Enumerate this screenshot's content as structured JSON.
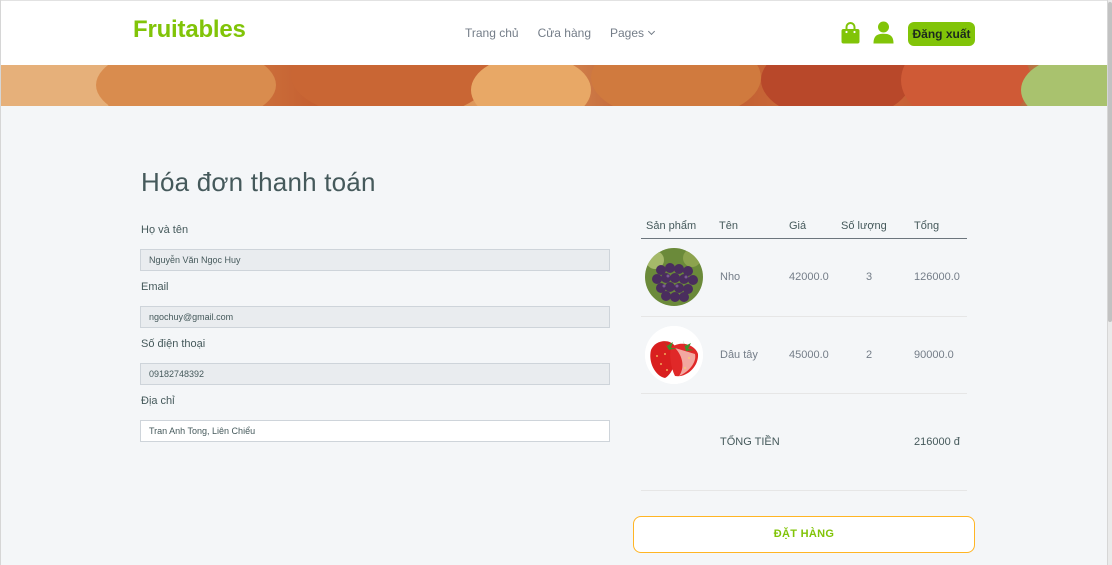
{
  "header": {
    "brand": "Fruitables",
    "nav": {
      "home": "Trang chủ",
      "shop": "Cửa hàng",
      "pages": "Pages"
    },
    "logout_label": "Đăng xuất",
    "accent_color": "#81c408"
  },
  "checkout": {
    "title": "Hóa đơn thanh toán",
    "fields": [
      {
        "label": "Họ và tên",
        "value": "Nguyễn Văn Ngọc Huy"
      },
      {
        "label": "Email",
        "value": "ngochuy@gmail.com"
      },
      {
        "label": "Số điện thoại",
        "value": "09182748392"
      },
      {
        "label": "Địa chỉ",
        "value": "Tran Anh Tong, Liên Chiểu"
      }
    ]
  },
  "cart": {
    "columns": [
      "Sản phẩm",
      "Tên",
      "Giá",
      "Số lượng",
      "Tổng"
    ],
    "items": [
      {
        "image": "grapes-image",
        "name": "Nho",
        "price": "42000.0",
        "qty": "3",
        "total": "126000.0"
      },
      {
        "image": "strawberry-image",
        "name": "Dâu tây",
        "price": "45000.0",
        "qty": "2",
        "total": "90000.0"
      }
    ],
    "total_label": "TỔNG TIỀN",
    "total_value": "216000 đ",
    "order_button": "ĐẶT HÀNG",
    "order_button_border": "#ffb524"
  }
}
